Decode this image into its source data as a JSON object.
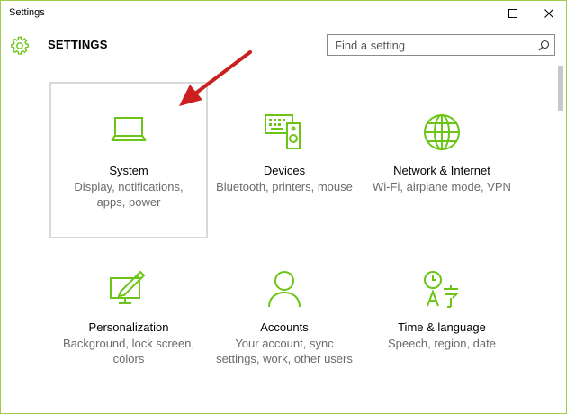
{
  "window": {
    "title": "Settings"
  },
  "header": {
    "title": "SETTINGS",
    "search_placeholder": "Find a setting"
  },
  "tiles": [
    {
      "label": "System",
      "desc": "Display, notifications, apps, power"
    },
    {
      "label": "Devices",
      "desc": "Bluetooth, printers, mouse"
    },
    {
      "label": "Network & Internet",
      "desc": "Wi-Fi, airplane mode, VPN"
    },
    {
      "label": "Personalization",
      "desc": "Background, lock screen, colors"
    },
    {
      "label": "Accounts",
      "desc": "Your account, sync settings, work, other users"
    },
    {
      "label": "Time & language",
      "desc": "Speech, region, date"
    }
  ],
  "colors": {
    "accent": "#6cc417",
    "arrow": "#cc1f1f",
    "border": "#9ccc4f"
  },
  "icons": [
    "gear-icon",
    "search-icon",
    "laptop-icon",
    "keyboard-speaker-icon",
    "globe-icon",
    "paint-monitor-icon",
    "person-icon",
    "clock-language-icon"
  ]
}
